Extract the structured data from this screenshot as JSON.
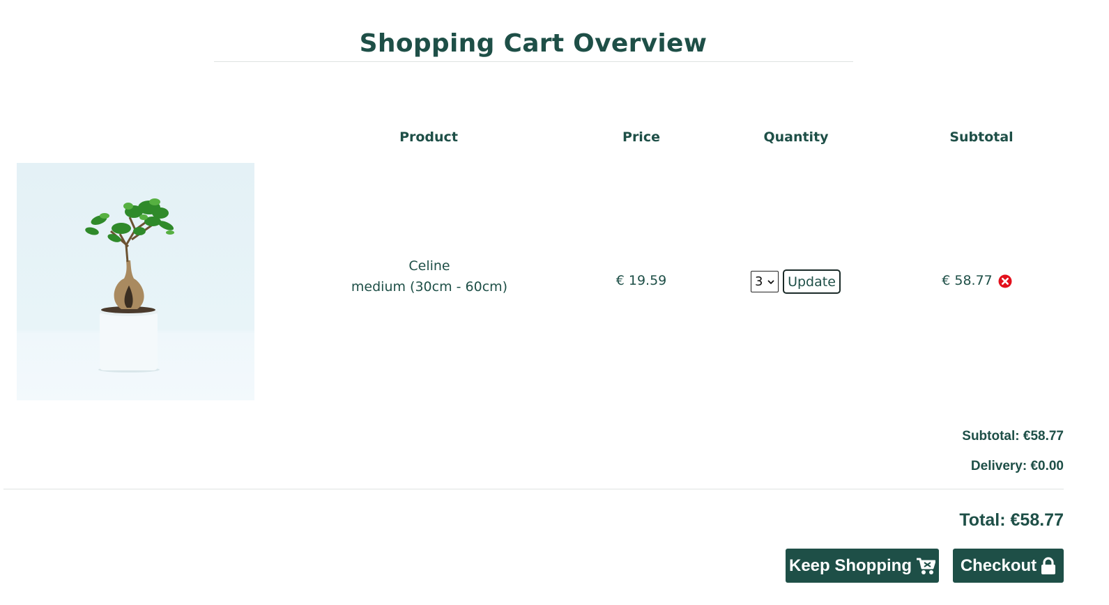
{
  "page": {
    "title": "Shopping Cart Overview"
  },
  "table": {
    "headers": {
      "product": "Product",
      "price": "Price",
      "quantity": "Quantity",
      "subtotal": "Subtotal"
    }
  },
  "item": {
    "name": "Celine",
    "size": "medium (30cm - 60cm)",
    "price": "€ 19.59",
    "quantity": "3",
    "update_label": "Update",
    "subtotal": "€ 58.77"
  },
  "summary": {
    "subtotal": "Subtotal: €58.77",
    "delivery": "Delivery: €0.00",
    "total": "Total: €58.77"
  },
  "buttons": {
    "keep_shopping": "Keep Shopping",
    "checkout": "Checkout"
  },
  "icons": {
    "remove": "times-circle-icon",
    "keep_shopping": "shopping-cart-icon",
    "checkout": "lock-icon"
  },
  "colors": {
    "brand": "#1e4f47",
    "remove": "#e3101c"
  }
}
